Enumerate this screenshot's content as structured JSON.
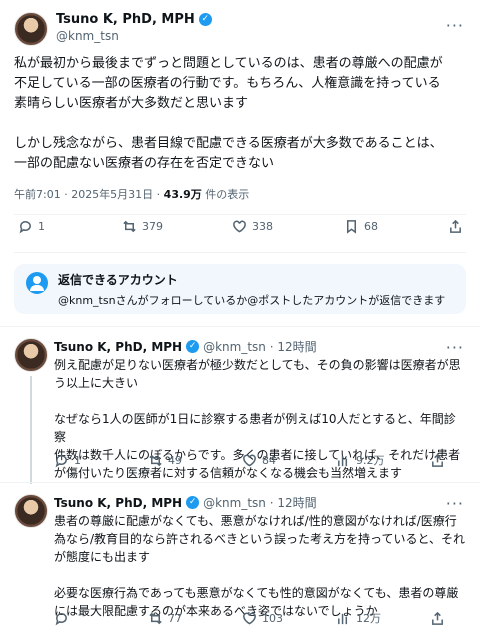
{
  "author": {
    "name": "Tsuno K, PhD, MPH",
    "handle": "@knm_tsn"
  },
  "main_tweet": {
    "text": "私が最初から最後までずっと問題としているのは、患者の尊厳への配慮が\n不足している一部の医療者の行動です。もちろん、人権意識を持っている\n素晴らしい医療者が大多数だと思います\n\nしかし残念ながら、患者目線で配慮できる医療者が大多数であることは、\n一部の配慮ない医療者の存在を否定できない",
    "timestamp": "午前7:01 · 2025年5月31日 · ",
    "views": "43.9万",
    "views_suffix": " 件の表示",
    "replies": "1",
    "retweets": "379",
    "likes": "338",
    "bookmarks": "68"
  },
  "reply_notice": {
    "title": "返信できるアカウント",
    "description": "@knm_tsnさんがフォローしているか@ポストしたアカウントが返信できます"
  },
  "replies": [
    {
      "name": "Tsuno K, PhD, MPH",
      "meta": "@knm_tsn · 12時間",
      "text": "例え配慮が足りない医療者が極少数だとしても、その負の影響は医療者が思\nう以上に大きい\n\nなぜなら1人の医師が1日に診察する患者が例えば10人だとすると、年間診察\n件数は数千人にのぼるからです。多くの患者に接していれば、それだけ患者\nが傷付いたり医療者に対する信頼がなくなる機会も当然増えます",
      "replies": "1",
      "retweets": "49",
      "likes": "84",
      "views": "9.2万"
    },
    {
      "name": "Tsuno K, PhD, MPH",
      "meta": "@knm_tsn · 12時間",
      "text": "患者の尊厳に配慮がなくても、悪意がなければ/性的意図がなければ/医療行\n為なら/教育目的なら許されるべきという誤った考え方を持っていると、それ\nが態度にも出ます\n\n必要な医療行為であっても悪意がなくても性的意図がなくても、患者の尊厳\nには最大限配慮するのが本来あるべき姿ではないでしょうか",
      "replies": "",
      "retweets": "77",
      "likes": "103",
      "views": "12万"
    }
  ]
}
